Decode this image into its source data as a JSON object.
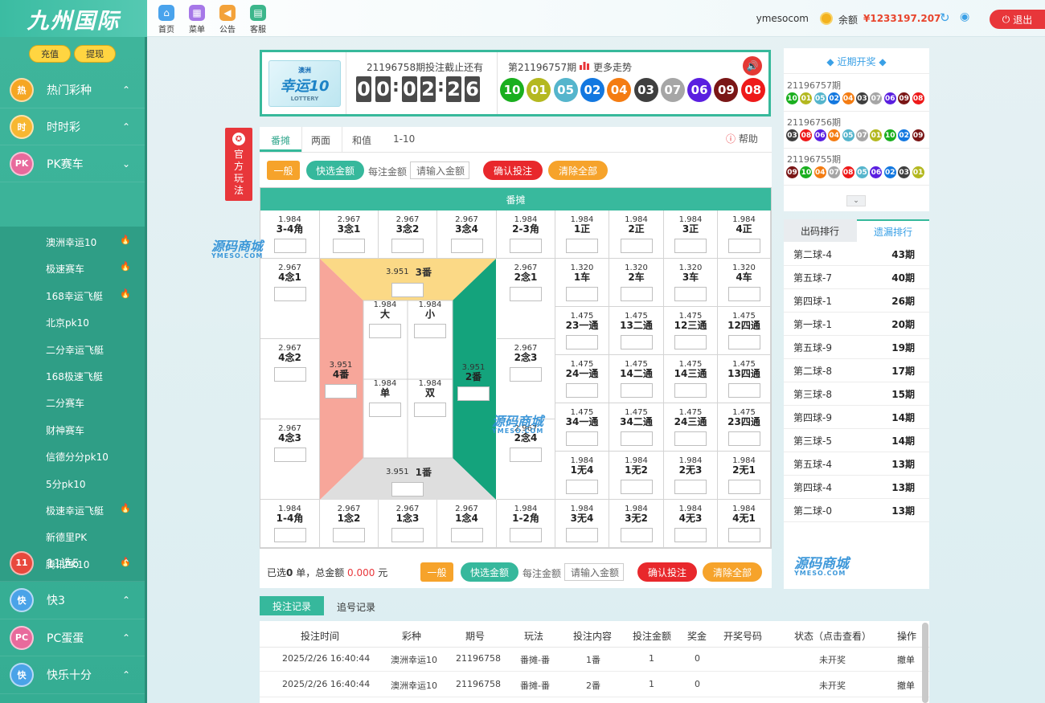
{
  "header": {
    "logo_text": "九州国际",
    "nav": [
      {
        "label": "首页",
        "icon": "home-icon",
        "color": "#49a3ec"
      },
      {
        "label": "菜单",
        "icon": "grid-icon",
        "color": "#a678e8"
      },
      {
        "label": "公告",
        "icon": "megaphone-icon",
        "color": "#f3a23a"
      },
      {
        "label": "客服",
        "icon": "chat-icon",
        "color": "#3cb68b"
      }
    ],
    "username": "ymesocom",
    "balance_label": "余额",
    "balance_value": "¥1233197.207",
    "logout_label": "退出"
  },
  "sidebar": {
    "recharge_label": "充值",
    "withdraw_label": "提现",
    "categories": [
      {
        "label": "热门彩种",
        "icon_text": "热",
        "color": "#f5a623",
        "arrow": "⌃"
      },
      {
        "label": "时时彩",
        "icon_text": "时",
        "color": "#f7b731",
        "arrow": "⌃"
      },
      {
        "label": "PK赛车",
        "icon_text": "PK",
        "color": "#e86a9c",
        "arrow": "⌄"
      }
    ],
    "sub_items": [
      {
        "label": "澳洲幸运10",
        "hot": true
      },
      {
        "label": "极速赛车",
        "hot": true
      },
      {
        "label": "168幸运飞艇",
        "hot": true
      },
      {
        "label": "北京pk10",
        "hot": false
      },
      {
        "label": "二分幸运飞艇",
        "hot": false
      },
      {
        "label": "168极速飞艇",
        "hot": false
      },
      {
        "label": "二分赛车",
        "hot": false
      },
      {
        "label": "财神赛车",
        "hot": false
      },
      {
        "label": "信德分分pk10",
        "hot": false
      },
      {
        "label": "5分pk10",
        "hot": false
      },
      {
        "label": "极速幸运飞艇",
        "hot": true
      },
      {
        "label": "新德里PK",
        "hot": false
      },
      {
        "label": "腾讯PK10",
        "hot": true
      }
    ],
    "categories_bottom": [
      {
        "label": "11选5",
        "icon_text": "11",
        "color": "#e8493d"
      },
      {
        "label": "快3",
        "icon_text": "快",
        "color": "#4aa3e8"
      },
      {
        "label": "PC蛋蛋",
        "icon_text": "PC",
        "color": "#e86a9c"
      },
      {
        "label": "快乐十分",
        "icon_text": "快",
        "color": "#4aa3e8"
      }
    ]
  },
  "lottery": {
    "logo_top": "澳洲",
    "logo_main": "幸运10",
    "logo_sub": "LOTTERY",
    "countdown_title": "21196758期投注截止还有",
    "countdown_digits": [
      "0",
      "0",
      "0",
      "2",
      "2",
      "6"
    ],
    "prev_issue": "第21196757期",
    "trend_label": "更多走势",
    "balls": [
      {
        "n": "10",
        "c": "#1aaf1f"
      },
      {
        "n": "01",
        "c": "#b4b820"
      },
      {
        "n": "05",
        "c": "#55b5cc"
      },
      {
        "n": "02",
        "c": "#1378e0"
      },
      {
        "n": "04",
        "c": "#f47c12"
      },
      {
        "n": "03",
        "c": "#3f3f3f"
      },
      {
        "n": "07",
        "c": "#a6a6a6"
      },
      {
        "n": "06",
        "c": "#5a1fe0"
      },
      {
        "n": "09",
        "c": "#7a1616"
      },
      {
        "n": "08",
        "c": "#ee1a1a"
      }
    ]
  },
  "official_tag": [
    "官",
    "方",
    "玩",
    "法"
  ],
  "board": {
    "tabs": [
      "番摊",
      "两面",
      "和值",
      "1-10"
    ],
    "help_label": "帮助",
    "btn_normal": "一般",
    "btn_quick": "快选金额",
    "per_bet_label": "每注金额",
    "amount_placeholder": "请输入金额",
    "btn_confirm": "确认投注",
    "btn_clear": "清除全部",
    "grid_title": "番摊",
    "top_row": [
      {
        "od": "1.984",
        "nm": "3-4角"
      },
      {
        "od": "2.967",
        "nm": "3念1"
      },
      {
        "od": "2.967",
        "nm": "3念2"
      },
      {
        "od": "2.967",
        "nm": "3念4"
      },
      {
        "od": "1.984",
        "nm": "2-3角"
      }
    ],
    "bottom_row": [
      {
        "od": "1.984",
        "nm": "1-4角"
      },
      {
        "od": "2.967",
        "nm": "1念2"
      },
      {
        "od": "2.967",
        "nm": "1念3"
      },
      {
        "od": "2.967",
        "nm": "1念4"
      },
      {
        "od": "1.984",
        "nm": "1-2角"
      }
    ],
    "left_col": [
      {
        "od": "2.967",
        "nm": "4念1"
      },
      {
        "od": "2.967",
        "nm": "4念2"
      },
      {
        "od": "2.967",
        "nm": "4念3"
      }
    ],
    "right_col": [
      {
        "od": "2.967",
        "nm": "2念1"
      },
      {
        "od": "2.967",
        "nm": "2念3"
      },
      {
        "od": "2.967",
        "nm": "2念4"
      }
    ],
    "fan3": {
      "od": "3.951",
      "nm": "3番"
    },
    "fan4": {
      "od": "3.951",
      "nm": "4番"
    },
    "fan2": {
      "od": "3.951",
      "nm": "2番"
    },
    "fan1": {
      "od": "3.951",
      "nm": "1番"
    },
    "center": [
      {
        "od": "1.984",
        "nm": "大"
      },
      {
        "od": "1.984",
        "nm": "小"
      },
      {
        "od": "1.984",
        "nm": "单"
      },
      {
        "od": "1.984",
        "nm": "双"
      }
    ],
    "right_grid": [
      [
        {
          "od": "1.984",
          "nm": "1正"
        },
        {
          "od": "1.984",
          "nm": "2正"
        },
        {
          "od": "1.984",
          "nm": "3正"
        },
        {
          "od": "1.984",
          "nm": "4正"
        }
      ],
      [
        {
          "od": "1.320",
          "nm": "1车"
        },
        {
          "od": "1.320",
          "nm": "2车"
        },
        {
          "od": "1.320",
          "nm": "3车"
        },
        {
          "od": "1.320",
          "nm": "4车"
        }
      ],
      [
        {
          "od": "1.475",
          "nm": "23一通"
        },
        {
          "od": "1.475",
          "nm": "13二通"
        },
        {
          "od": "1.475",
          "nm": "12三通"
        },
        {
          "od": "1.475",
          "nm": "12四通"
        }
      ],
      [
        {
          "od": "1.475",
          "nm": "24一通"
        },
        {
          "od": "1.475",
          "nm": "14二通"
        },
        {
          "od": "1.475",
          "nm": "14三通"
        },
        {
          "od": "1.475",
          "nm": "13四通"
        }
      ],
      [
        {
          "od": "1.475",
          "nm": "34一通"
        },
        {
          "od": "1.475",
          "nm": "34二通"
        },
        {
          "od": "1.475",
          "nm": "24三通"
        },
        {
          "od": "1.475",
          "nm": "23四通"
        }
      ],
      [
        {
          "od": "1.984",
          "nm": "1无4"
        },
        {
          "od": "1.984",
          "nm": "1无2"
        },
        {
          "od": "1.984",
          "nm": "2无3"
        },
        {
          "od": "1.984",
          "nm": "2无1"
        }
      ],
      [
        {
          "od": "1.984",
          "nm": "3无4"
        },
        {
          "od": "1.984",
          "nm": "3无2"
        },
        {
          "od": "1.984",
          "nm": "4无3"
        },
        {
          "od": "1.984",
          "nm": "4无1"
        }
      ]
    ],
    "selected_prefix": "已选",
    "selected_count": "0",
    "selected_mid": "单，总金额",
    "total_amount": "0.000",
    "currency": "元"
  },
  "recent": {
    "title": "近期开奖",
    "draws": [
      {
        "issue": "21196757期",
        "balls": [
          "10",
          "01",
          "05",
          "02",
          "04",
          "03",
          "07",
          "06",
          "09",
          "08"
        ]
      },
      {
        "issue": "21196756期",
        "balls": [
          "03",
          "08",
          "06",
          "04",
          "05",
          "07",
          "01",
          "10",
          "02",
          "09"
        ]
      },
      {
        "issue": "21196755期",
        "balls": [
          "09",
          "10",
          "04",
          "07",
          "08",
          "05",
          "06",
          "02",
          "03",
          "01"
        ]
      }
    ],
    "ball_colors": {
      "01": "#b4b820",
      "02": "#1378e0",
      "03": "#3f3f3f",
      "04": "#f47c12",
      "05": "#55b5cc",
      "06": "#5a1fe0",
      "07": "#a6a6a6",
      "08": "#ee1a1a",
      "09": "#7a1616",
      "10": "#1aaf1f"
    }
  },
  "ranking": {
    "tab1": "出码排行",
    "tab2": "遗漏排行",
    "rows": [
      {
        "a": "第二球-4",
        "b": "43期"
      },
      {
        "a": "第五球-7",
        "b": "40期"
      },
      {
        "a": "第四球-1",
        "b": "26期"
      },
      {
        "a": "第一球-1",
        "b": "20期"
      },
      {
        "a": "第五球-9",
        "b": "19期"
      },
      {
        "a": "第二球-8",
        "b": "17期"
      },
      {
        "a": "第三球-8",
        "b": "15期"
      },
      {
        "a": "第四球-9",
        "b": "14期"
      },
      {
        "a": "第三球-5",
        "b": "14期"
      },
      {
        "a": "第五球-4",
        "b": "13期"
      },
      {
        "a": "第四球-4",
        "b": "13期"
      },
      {
        "a": "第二球-0",
        "b": "13期"
      }
    ]
  },
  "watermark": {
    "main": "源码商城",
    "sub": "YMESO.COM"
  },
  "records": {
    "tab1": "投注记录",
    "tab2": "追号记录",
    "headers": [
      "投注时间",
      "彩种",
      "期号",
      "玩法",
      "投注内容",
      "投注金额",
      "奖金",
      "开奖号码",
      "状态（点击查看）",
      "操作"
    ],
    "rows": [
      [
        "2025/2/26 16:40:44",
        "澳洲幸运10",
        "21196758",
        "番摊-番",
        "1番",
        "1",
        "0",
        "",
        "未开奖",
        "撤单"
      ],
      [
        "2025/2/26 16:40:44",
        "澳洲幸运10",
        "21196758",
        "番摊-番",
        "2番",
        "1",
        "0",
        "",
        "未开奖",
        "撤单"
      ]
    ]
  }
}
